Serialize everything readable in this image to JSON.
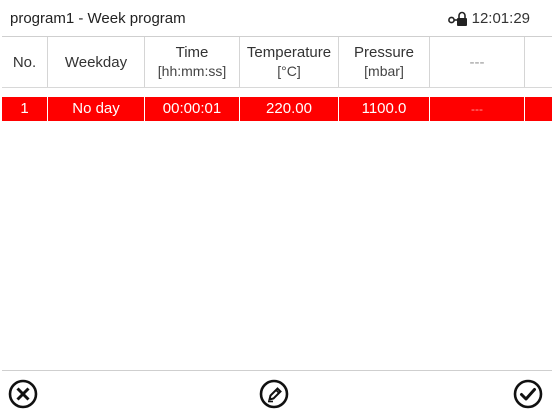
{
  "header": {
    "title": "program1 - Week program",
    "time": "12:01:29",
    "lock_icon": "lock-open-icon"
  },
  "table": {
    "columns": [
      {
        "label": "No.",
        "unit": ""
      },
      {
        "label": "Weekday",
        "unit": ""
      },
      {
        "label": "Time",
        "unit": "[hh:mm:ss]"
      },
      {
        "label": "Temperature",
        "unit": "[°C]"
      },
      {
        "label": "Pressure",
        "unit": "[mbar]"
      },
      {
        "label": "---",
        "unit": ""
      }
    ],
    "rows": [
      {
        "no": "1",
        "weekday": "No day",
        "time": "00:00:01",
        "temperature": "220.00",
        "pressure": "1100.0",
        "extra": "---"
      }
    ],
    "selected_row_color": "#ff0000"
  },
  "toolbar": {
    "cancel_icon": "close-circle-icon",
    "edit_icon": "edit-pencil-icon",
    "confirm_icon": "check-circle-icon"
  }
}
